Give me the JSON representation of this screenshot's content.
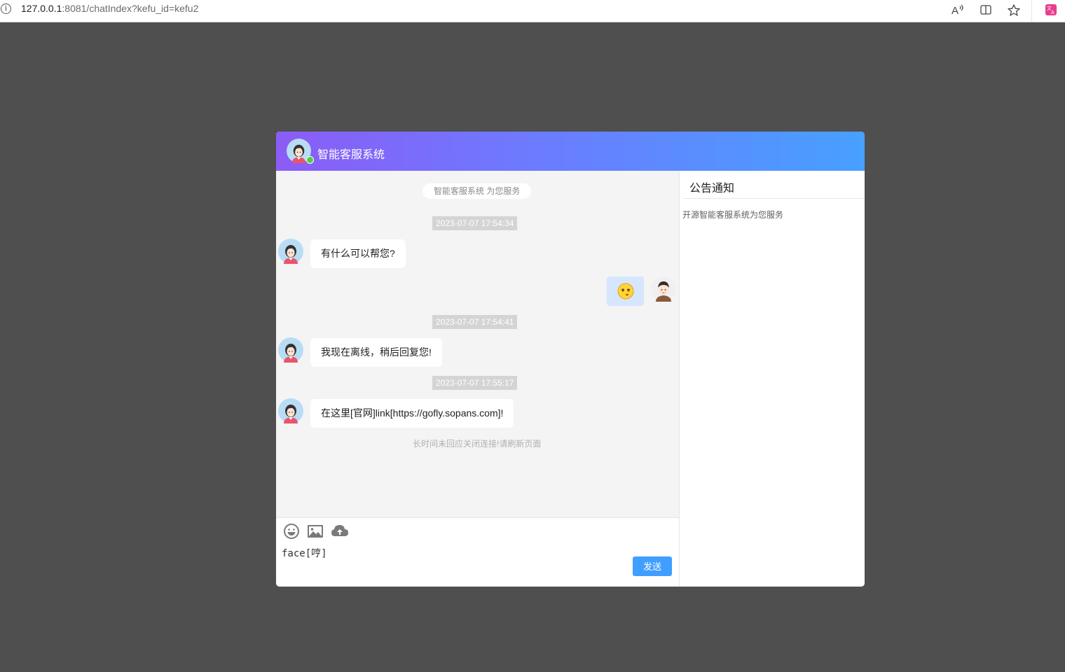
{
  "browser": {
    "url_host": "127.0.0.1",
    "url_rest": ":8081/chatIndex?kefu_id=kefu2",
    "info_icon": "info-icon",
    "icons": [
      "read-aloud-icon",
      "split-screen-icon",
      "favorite-star-icon",
      "translate-icon"
    ]
  },
  "header": {
    "title": "智能客服系统",
    "status": "online"
  },
  "chat": {
    "system_notice": "智能客服系统 为您服务",
    "messages": [
      {
        "type": "time",
        "text": "2023-07-07 17:54:34"
      },
      {
        "type": "agent",
        "text": "有什么可以帮您?"
      },
      {
        "type": "user",
        "emoji": "face-emoji-icon"
      },
      {
        "type": "time",
        "text": "2023-07-07 17:54:41"
      },
      {
        "type": "agent",
        "text": "我现在离线，稍后回复您!"
      },
      {
        "type": "time",
        "text": "2023-07-07 17:55:17"
      },
      {
        "type": "agent",
        "text": "在这里[官网]link[https://gofly.sopans.com]!"
      }
    ],
    "closed_note": "长时间未回应关闭连接!请刷新页面"
  },
  "input": {
    "tools": [
      "emoji-icon",
      "image-icon",
      "upload-cloud-icon"
    ],
    "value": "face[哼]",
    "send_label": "发送"
  },
  "sidebar": {
    "title": "公告通知",
    "content": "开源智能客服系统为您服务"
  },
  "colors": {
    "header_start": "#8b5cf6",
    "header_end": "#47a0ff",
    "send_button": "#409eff",
    "online": "#4cd137",
    "user_bubble": "#d6e6ff"
  }
}
